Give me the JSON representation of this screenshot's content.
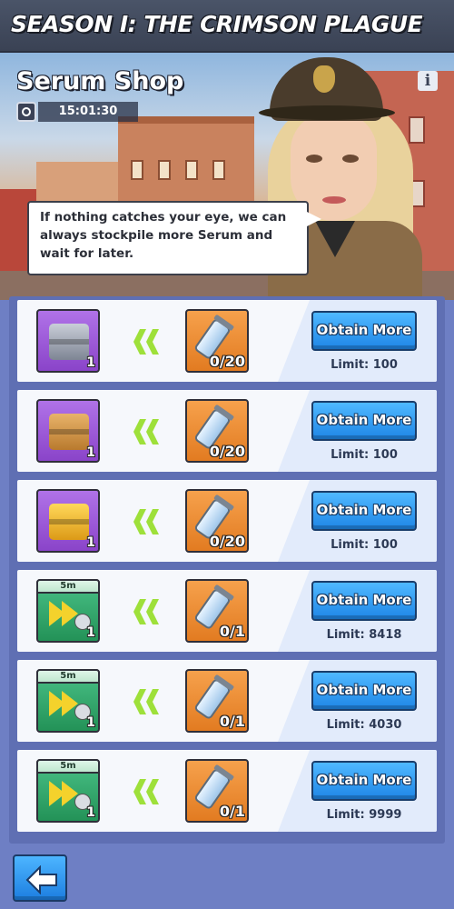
{
  "header": {
    "title": "SEASON I: THE CRIMSON PLAGUE"
  },
  "banner": {
    "title": "Serum Shop",
    "timer": "15:01:30",
    "dialogue": "If nothing catches your eye, we can always stockpile more Serum and wait for later."
  },
  "icons": {
    "info": "info-icon",
    "clock": "clock-icon",
    "back": "back-arrow-icon"
  },
  "colors": {
    "panel_bg": "#5f6fb3",
    "button_blue": "#1f86e6",
    "tile_purple": "#8a44c9",
    "tile_green": "#239257",
    "tile_orange": "#e27b21",
    "arrow_green": "#9ee03a"
  },
  "shop_items": [
    {
      "reward": "Gray Supply Crate",
      "reward_type": "chest-grey",
      "reward_qty": "1",
      "cost": "0/20",
      "button": "Obtain More",
      "limit": "Limit: 100"
    },
    {
      "reward": "Wood Supply Crate",
      "reward_type": "chest-wood",
      "reward_qty": "1",
      "cost": "0/20",
      "button": "Obtain More",
      "limit": "Limit: 100"
    },
    {
      "reward": "Gold Supply Crate",
      "reward_type": "chest-gold",
      "reward_qty": "1",
      "cost": "0/20",
      "button": "Obtain More",
      "limit": "Limit: 100"
    },
    {
      "reward": "5m Construction Speedup",
      "reward_type": "speedup-build",
      "time": "5m",
      "reward_qty": "1",
      "cost": "0/1",
      "button": "Obtain More",
      "limit": "Limit: 8418"
    },
    {
      "reward": "5m Research Speedup",
      "reward_type": "speedup-research",
      "time": "5m",
      "reward_qty": "1",
      "cost": "0/1",
      "button": "Obtain More",
      "limit": "Limit: 4030"
    },
    {
      "reward": "5m Training Speedup",
      "reward_type": "speedup-train",
      "time": "5m",
      "reward_qty": "1",
      "cost": "0/1",
      "button": "Obtain More",
      "limit": "Limit: 9999"
    }
  ]
}
